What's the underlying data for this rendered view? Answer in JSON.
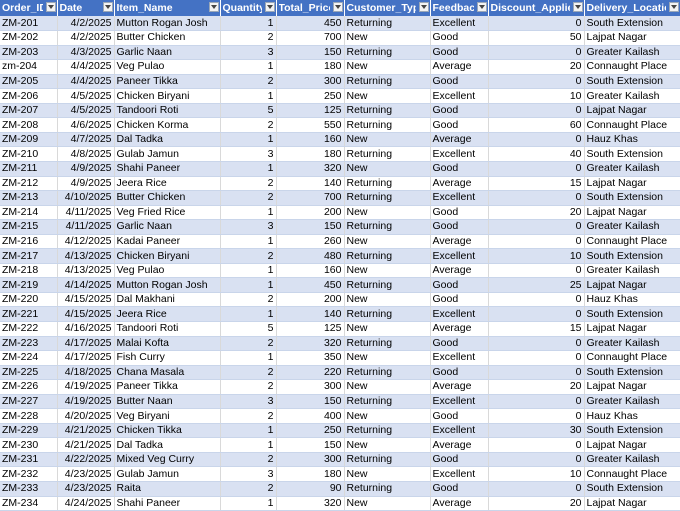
{
  "headers": [
    "Order_ID",
    "Date",
    "Item_Name",
    "Quantity",
    "Total_Price",
    "Customer_Type",
    "Feedback",
    "Discount_Applied",
    "Delivery_Location"
  ],
  "rows": [
    [
      "ZM-201",
      "4/2/2025",
      "Mutton Rogan Josh",
      "1",
      "450",
      "Returning",
      "Excellent",
      "0",
      "South Extension"
    ],
    [
      "ZM-202",
      "4/2/2025",
      "Butter Chicken",
      "2",
      "700",
      "New",
      "Good",
      "50",
      "Lajpat Nagar"
    ],
    [
      "ZM-203",
      "4/3/2025",
      "Garlic Naan",
      "3",
      "150",
      "Returning",
      "Good",
      "0",
      "Greater Kailash"
    ],
    [
      "zm-204",
      "4/4/2025",
      "Veg Pulao",
      "1",
      "180",
      "New",
      "Average",
      "20",
      "Connaught Place"
    ],
    [
      "ZM-205",
      "4/4/2025",
      "Paneer Tikka",
      "2",
      "300",
      "Returning",
      "Good",
      "0",
      "South Extension"
    ],
    [
      "ZM-206",
      "4/5/2025",
      "Chicken Biryani",
      "1",
      "250",
      "New",
      "Excellent",
      "10",
      "Greater Kailash"
    ],
    [
      "ZM-207",
      "4/5/2025",
      "Tandoori Roti",
      "5",
      "125",
      "Returning",
      "Good",
      "0",
      "Lajpat Nagar"
    ],
    [
      "ZM-208",
      "4/6/2025",
      "Chicken Korma",
      "2",
      "550",
      "Returning",
      "Good",
      "60",
      "Connaught Place"
    ],
    [
      "ZM-209",
      "4/7/2025",
      "Dal Tadka",
      "1",
      "160",
      "New",
      "Average",
      "0",
      "Hauz Khas"
    ],
    [
      "ZM-210",
      "4/8/2025",
      "Gulab Jamun",
      "3",
      "180",
      "Returning",
      "Excellent",
      "40",
      "South Extension"
    ],
    [
      "ZM-211",
      "4/9/2025",
      "Shahi Paneer",
      "1",
      "320",
      "New",
      "Good",
      "0",
      "Greater Kailash"
    ],
    [
      "ZM-212",
      "4/9/2025",
      "Jeera Rice",
      "2",
      "140",
      "Returning",
      "Average",
      "15",
      "Lajpat Nagar"
    ],
    [
      "ZM-213",
      "4/10/2025",
      "Butter Chicken",
      "2",
      "700",
      "Returning",
      "Excellent",
      "0",
      "South Extension"
    ],
    [
      "ZM-214",
      "4/11/2025",
      "Veg Fried Rice",
      "1",
      "200",
      "New",
      "Good",
      "20",
      "Lajpat Nagar"
    ],
    [
      "ZM-215",
      "4/11/2025",
      "Garlic Naan",
      "3",
      "150",
      "Returning",
      "Good",
      "0",
      "Greater Kailash"
    ],
    [
      "ZM-216",
      "4/12/2025",
      "Kadai Paneer",
      "1",
      "260",
      "New",
      "Average",
      "0",
      "Connaught Place"
    ],
    [
      "ZM-217",
      "4/13/2025",
      "Chicken Biryani",
      "2",
      "480",
      "Returning",
      "Excellent",
      "10",
      "South Extension"
    ],
    [
      "ZM-218",
      "4/13/2025",
      "Veg Pulao",
      "1",
      "160",
      "New",
      "Average",
      "0",
      "Greater Kailash"
    ],
    [
      "ZM-219",
      "4/14/2025",
      "Mutton Rogan Josh",
      "1",
      "450",
      "Returning",
      "Good",
      "25",
      "Lajpat Nagar"
    ],
    [
      "ZM-220",
      "4/15/2025",
      "Dal Makhani",
      "2",
      "200",
      "New",
      "Good",
      "0",
      "Hauz Khas"
    ],
    [
      "ZM-221",
      "4/15/2025",
      "Jeera Rice",
      "1",
      "140",
      "Returning",
      "Excellent",
      "0",
      "South Extension"
    ],
    [
      "ZM-222",
      "4/16/2025",
      "Tandoori Roti",
      "5",
      "125",
      "New",
      "Average",
      "15",
      "Lajpat Nagar"
    ],
    [
      "ZM-223",
      "4/17/2025",
      "Malai Kofta",
      "2",
      "320",
      "Returning",
      "Good",
      "0",
      "Greater Kailash"
    ],
    [
      "ZM-224",
      "4/17/2025",
      "Fish Curry",
      "1",
      "350",
      "New",
      "Excellent",
      "0",
      "Connaught Place"
    ],
    [
      "ZM-225",
      "4/18/2025",
      "Chana Masala",
      "2",
      "220",
      "Returning",
      "Good",
      "0",
      "South Extension"
    ],
    [
      "ZM-226",
      "4/19/2025",
      "Paneer Tikka",
      "2",
      "300",
      "New",
      "Average",
      "20",
      "Lajpat Nagar"
    ],
    [
      "ZM-227",
      "4/19/2025",
      "Butter Naan",
      "3",
      "150",
      "Returning",
      "Excellent",
      "0",
      "Greater Kailash"
    ],
    [
      "ZM-228",
      "4/20/2025",
      "Veg Biryani",
      "2",
      "400",
      "New",
      "Good",
      "0",
      "Hauz Khas"
    ],
    [
      "ZM-229",
      "4/21/2025",
      "Chicken Tikka",
      "1",
      "250",
      "Returning",
      "Excellent",
      "30",
      "South Extension"
    ],
    [
      "ZM-230",
      "4/21/2025",
      "Dal Tadka",
      "1",
      "150",
      "New",
      "Average",
      "0",
      "Lajpat Nagar"
    ],
    [
      "ZM-231",
      "4/22/2025",
      "Mixed Veg Curry",
      "2",
      "300",
      "Returning",
      "Good",
      "0",
      "Greater Kailash"
    ],
    [
      "ZM-232",
      "4/23/2025",
      "Gulab Jamun",
      "3",
      "180",
      "New",
      "Excellent",
      "10",
      "Connaught Place"
    ],
    [
      "ZM-233",
      "4/23/2025",
      "Raita",
      "2",
      "90",
      "Returning",
      "Good",
      "0",
      "South Extension"
    ],
    [
      "ZM-234",
      "4/24/2025",
      "Shahi Paneer",
      "1",
      "320",
      "New",
      "Average",
      "20",
      "Lajpat Nagar"
    ]
  ],
  "colors": {
    "header_bg": "#4472c4",
    "band_bg": "#d9e1f2"
  },
  "icons": {
    "filter": "filter-dropdown-icon"
  }
}
